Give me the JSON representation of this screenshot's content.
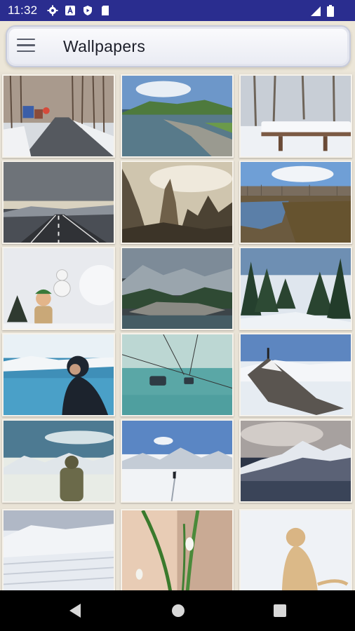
{
  "status_bar": {
    "time": "11:32",
    "left_icons": [
      "settings-icon",
      "font-icon",
      "play-protect-icon",
      "sd-card-icon"
    ],
    "right_icons": [
      "signal-icon",
      "battery-icon"
    ]
  },
  "app_bar": {
    "title": "Wallpapers",
    "menu_icon": "hamburger-menu-icon"
  },
  "wallpapers": [
    {
      "name": "snowy-road-with-trucks"
    },
    {
      "name": "lake-with-stone-pier"
    },
    {
      "name": "snow-covered-bench"
    },
    {
      "name": "empty-highway-mountains"
    },
    {
      "name": "sepia-rocky-peaks"
    },
    {
      "name": "flooded-field"
    },
    {
      "name": "child-with-snowman"
    },
    {
      "name": "mountain-lake-forest"
    },
    {
      "name": "snowy-pine-forest"
    },
    {
      "name": "hiker-in-hood-by-lake"
    },
    {
      "name": "cable-car-gondolas"
    },
    {
      "name": "climber-on-rocky-summit"
    },
    {
      "name": "backpacker-facing-mountains"
    },
    {
      "name": "skiers-on-snow-slope"
    },
    {
      "name": "snowy-mountains-over-lake"
    },
    {
      "name": "snow-field-horizon"
    },
    {
      "name": "snowdrop-flowers"
    },
    {
      "name": "golden-retriever-in-snow"
    }
  ],
  "navigation_bar": {
    "buttons": [
      "back-button",
      "home-button",
      "recents-button"
    ]
  }
}
